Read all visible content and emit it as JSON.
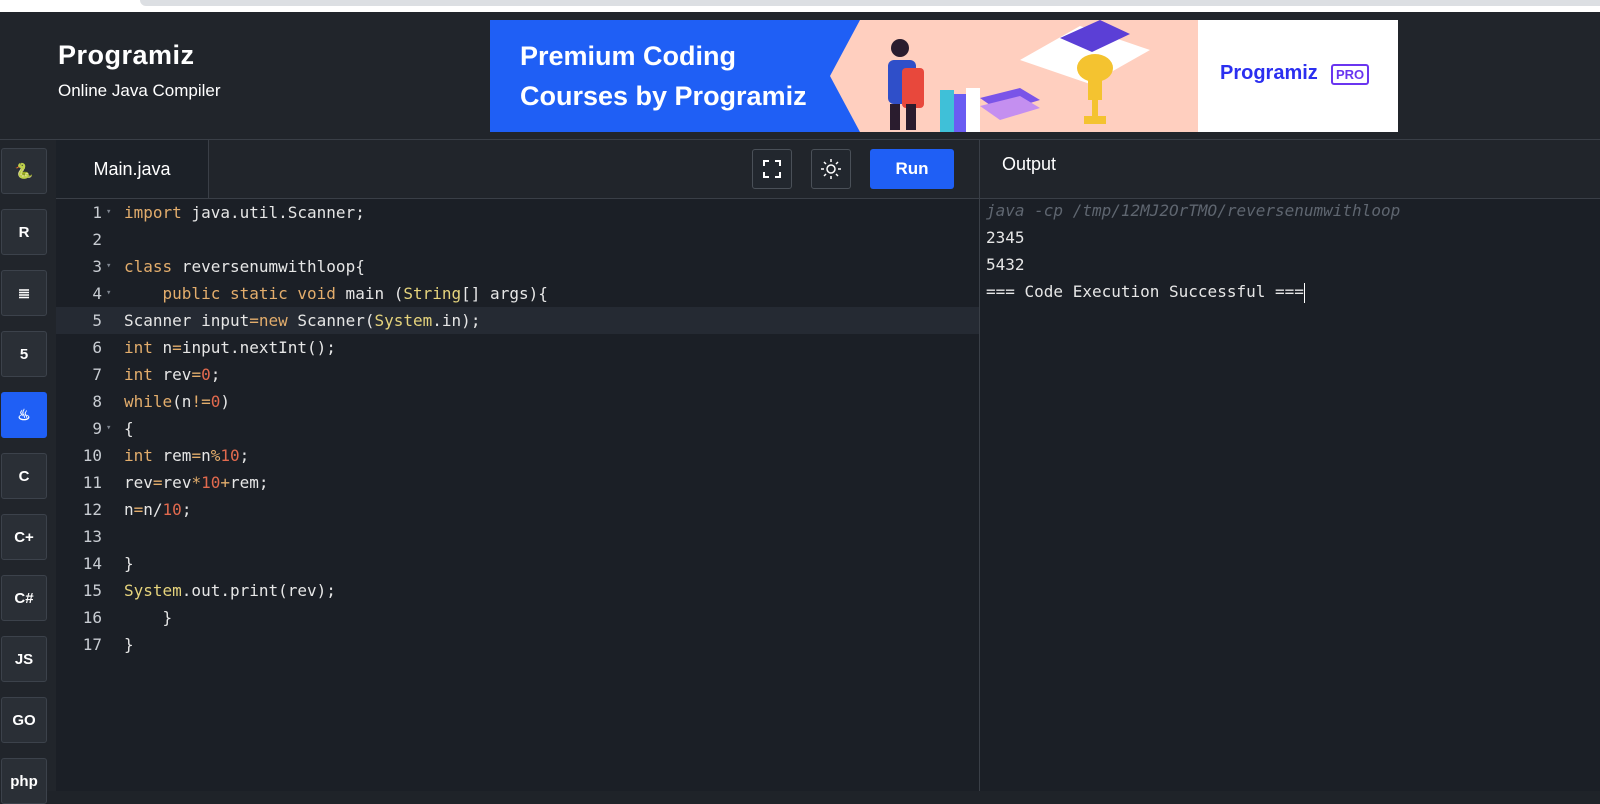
{
  "brand": {
    "name": "Programiz",
    "subtitle": "Online Java Compiler"
  },
  "banner": {
    "line1": "Premium Coding",
    "line2": "Courses by Programiz",
    "pro_brand": "Programiz",
    "pro_badge": "PRO"
  },
  "sidebar": {
    "items": [
      {
        "name": "python",
        "glyph": "🐍",
        "icon": "python-icon"
      },
      {
        "name": "r",
        "glyph": "R",
        "icon": "r-icon"
      },
      {
        "name": "sql",
        "glyph": "≣",
        "icon": "database-icon"
      },
      {
        "name": "html",
        "glyph": "5",
        "icon": "html5-icon"
      },
      {
        "name": "java",
        "glyph": "♨",
        "icon": "java-icon",
        "active": true
      },
      {
        "name": "c",
        "glyph": "C",
        "icon": "c-icon"
      },
      {
        "name": "cpp",
        "glyph": "C+",
        "icon": "cpp-icon"
      },
      {
        "name": "csharp",
        "glyph": "C#",
        "icon": "csharp-icon"
      },
      {
        "name": "javascript",
        "glyph": "JS",
        "icon": "javascript-icon"
      },
      {
        "name": "go",
        "glyph": "GO",
        "icon": "go-icon"
      },
      {
        "name": "php",
        "glyph": "php",
        "icon": "php-icon"
      }
    ]
  },
  "editor": {
    "tab_label": "Main.java",
    "run_label": "Run",
    "fullscreen_icon": "fullscreen-icon",
    "theme_icon": "sun-icon",
    "highlighted_line": 5,
    "lines": [
      "import java.util.Scanner;",
      "",
      "class reversenumwithloop{",
      "    public static void main (String[] args){",
      "Scanner input=new Scanner(System.in);",
      "int n=input.nextInt();",
      "int rev=0;",
      "while(n!=0)",
      "{",
      "int rem=n%10;",
      "rev=rev*10+rem;",
      "n=n/10;",
      "",
      "}",
      "System.out.print(rev);",
      "    }",
      "}"
    ],
    "fold_lines": [
      1,
      3,
      4,
      9
    ]
  },
  "output": {
    "label": "Output",
    "command": "java -cp /tmp/12MJ2OrTMO/reversenumwithloop",
    "lines": [
      "2345",
      "5432",
      "=== Code Execution Successful ==="
    ]
  }
}
